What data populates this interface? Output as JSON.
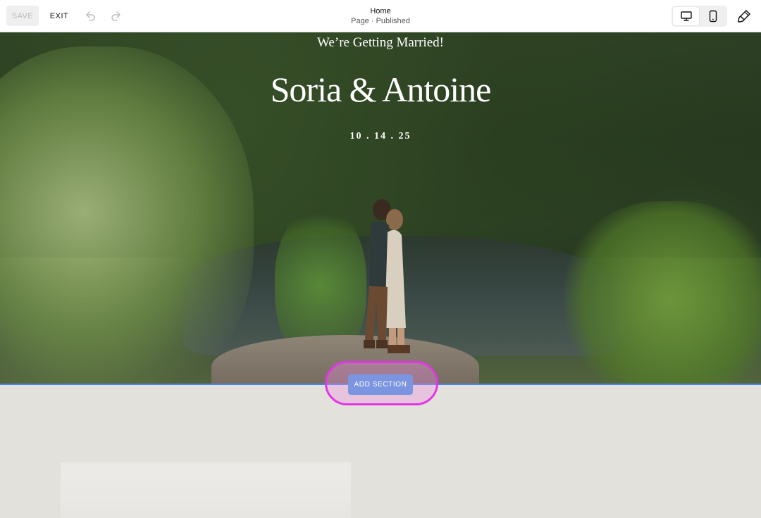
{
  "toolbar": {
    "save_label": "SAVE",
    "exit_label": "EXIT",
    "undo_icon": "undo-icon",
    "redo_icon": "redo-icon",
    "page_title": "Home",
    "page_status": "Page · Published",
    "devices": [
      "desktop-icon",
      "mobile-icon"
    ],
    "selected_device": "desktop",
    "design_icon": "paintbrush-icon"
  },
  "hero": {
    "subtitle": "We’re Getting Married!",
    "names": "Soria & Antoine",
    "date": "10 . 14 . 25"
  },
  "section": {
    "add_label": "ADD SECTION"
  },
  "colors": {
    "accent": "#4a83ea",
    "add_button": "#7c95e0",
    "highlight": "#e236e6",
    "lower_background": "#e2e1db"
  }
}
